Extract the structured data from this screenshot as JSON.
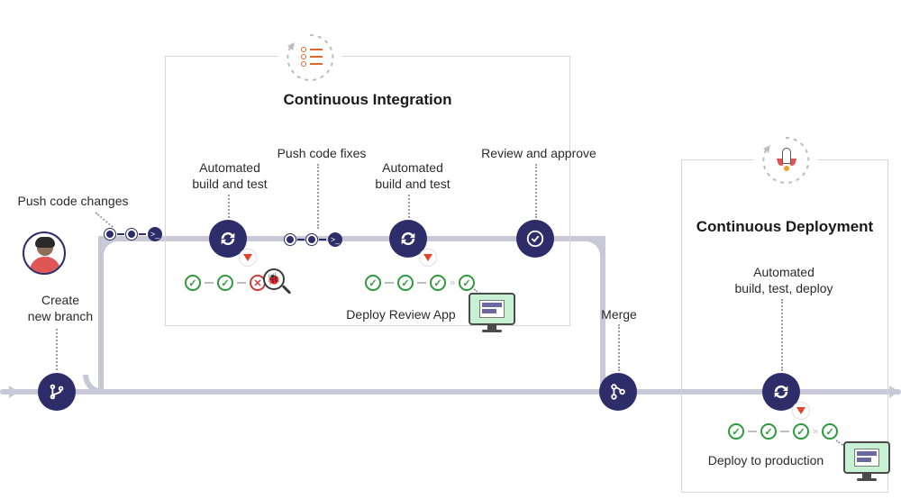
{
  "phases": {
    "ci": {
      "title": "Continuous Integration"
    },
    "cd": {
      "title": "Continuous Deployment"
    }
  },
  "steps": {
    "create_branch": "Create\nnew branch",
    "push_changes": "Push code changes",
    "build_test_1": "Automated\nbuild and test",
    "push_fixes": "Push code fixes",
    "build_test_2": "Automated\nbuild and test",
    "deploy_review_app": "Deploy Review App",
    "review_approve": "Review and approve",
    "merge": "Merge",
    "build_test_deploy": "Automated\nbuild, test, deploy",
    "deploy_production": "Deploy to production"
  },
  "status": {
    "pass": "✓",
    "fail": "✕"
  },
  "colors": {
    "node": "#2d2d6a",
    "pipe": "#c9c8d6",
    "pass": "#2d9a3d",
    "fail": "#d03a3a",
    "accent_orange": "#e06a2b"
  }
}
